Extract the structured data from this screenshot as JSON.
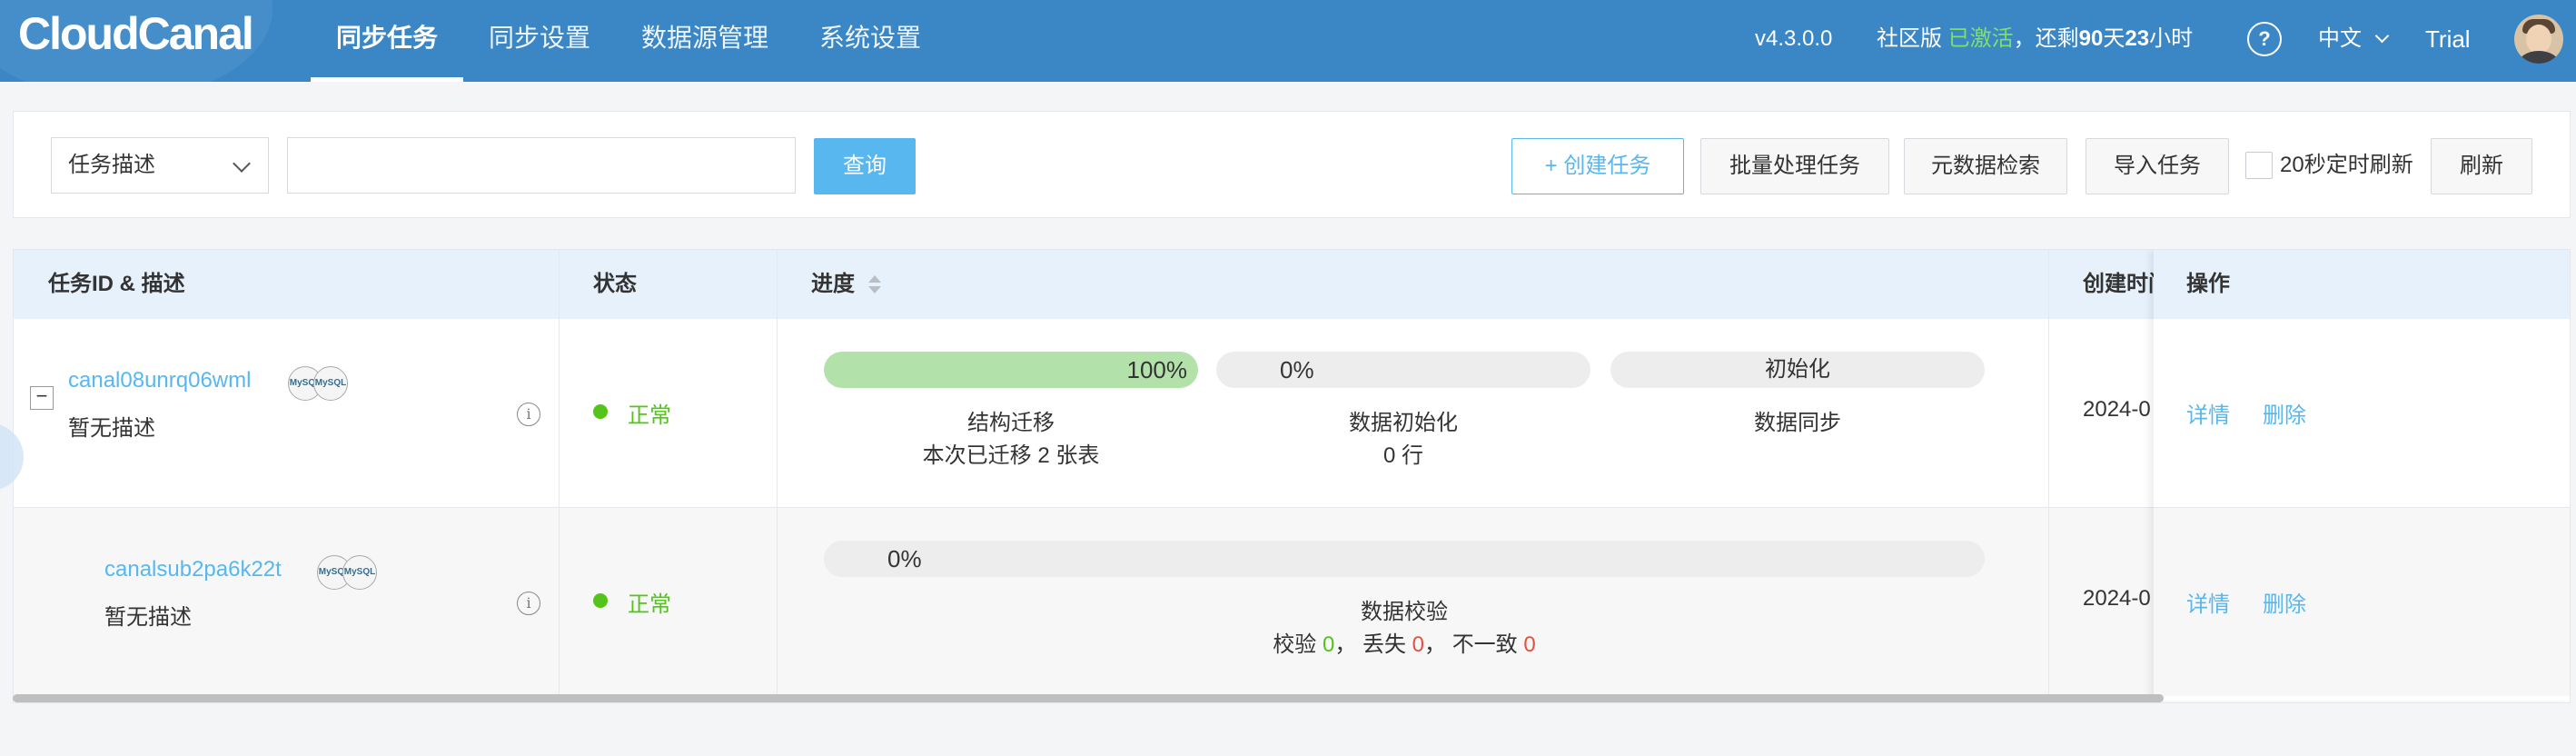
{
  "brand": {
    "logo": "CloudCanal"
  },
  "nav": {
    "items": [
      {
        "label": "同步任务",
        "active": true
      },
      {
        "label": "同步设置",
        "active": false
      },
      {
        "label": "数据源管理",
        "active": false
      },
      {
        "label": "系统设置",
        "active": false
      }
    ]
  },
  "topbar": {
    "version": "v4.3.0.0",
    "edition": "社区版",
    "activation": "已激活",
    "remaining_prefix": "，还剩",
    "remaining_days": "90",
    "days_unit": "天",
    "remaining_hours": "23",
    "hours_unit": "小时",
    "help": "?",
    "language": "中文",
    "user": "Trial"
  },
  "search": {
    "field_select": "任务描述",
    "input_value": "",
    "query_button": "查询"
  },
  "toolbar": {
    "create_button": "+ 创建任务",
    "batch_button": "批量处理任务",
    "metadata_button": "元数据检索",
    "import_button": "导入任务",
    "auto_refresh_label": "20秒定时刷新",
    "auto_refresh_checked": false,
    "refresh_button": "刷新"
  },
  "table": {
    "columns": [
      "任务ID & 描述",
      "状态",
      "进度",
      "创建时间",
      "操作"
    ],
    "rows": [
      {
        "task_id": "canal08unrq06wml",
        "description": "暂无描述",
        "expand": "−",
        "source_icon": "MySQL",
        "target_icon": "MySQL",
        "status": "正常",
        "stages": [
          {
            "percent": "100%",
            "progress": 1.0,
            "name": "结构迁移",
            "detail": "本次已迁移 2 张表"
          },
          {
            "percent": "0%",
            "progress": 0.0,
            "name": "数据初始化",
            "detail": "0 行"
          },
          {
            "percent": "初始化",
            "progress": 0.0,
            "name": "数据同步",
            "detail": ""
          }
        ],
        "created": "2024-0",
        "actions": [
          "详情",
          "删除"
        ]
      },
      {
        "task_id": "canalsub2pa6k22t",
        "description": "暂无描述",
        "source_icon": "MySQL",
        "target_icon": "MySQL",
        "status": "正常",
        "stage": {
          "percent": "0%",
          "progress": 0.0,
          "name": "数据校验",
          "check_label": "校验",
          "check_value": "0",
          "lost_label": "丢失",
          "lost_value": "0",
          "mismatch_label": "不一致",
          "mismatch_value": "0",
          "sep": "，"
        },
        "created": "2024-0",
        "actions": [
          "详情",
          "删除"
        ]
      }
    ]
  },
  "colors": {
    "nav_bg": "#3b87c6",
    "accent": "#58b7ee",
    "success": "#52c41a",
    "progress_fill": "#b2e2a9",
    "danger": "#e8503e"
  }
}
